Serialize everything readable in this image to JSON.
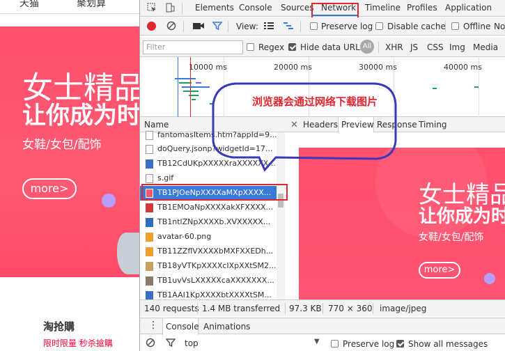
{
  "site": {
    "nav": [
      "天猫",
      "聚划算"
    ],
    "banner": {
      "line1": "女士精品",
      "line2": "让你成为时",
      "sub": "女鞋/女包/配饰",
      "more": "more>"
    },
    "section": {
      "title": "淘抢購",
      "sub": "限时限量 秒杀搶購"
    }
  },
  "devtools": {
    "tabs": [
      "Elements",
      "Console",
      "Sources",
      "Network",
      "Timeline",
      "Profiles",
      "Application"
    ],
    "toolbar": {
      "view": "View:",
      "preserve_log": "Preserve log",
      "disable_cache": "Disable cache",
      "offline": "Offline",
      "no": "No"
    },
    "filter": {
      "placeholder": "Filter",
      "regex": "Regex",
      "hide_data_urls": "Hide data URLs",
      "all": "All",
      "types": [
        "XHR",
        "JS",
        "CSS",
        "Img",
        "Media"
      ]
    },
    "timeline_labels": [
      "10000 ms",
      "20000 ms",
      "30000 ms",
      "40000 ms"
    ],
    "name_header": "Name",
    "requests": [
      "fantomasItems.htm?appId=9...",
      "doQuery.jsonp?widgetId=17...",
      "TB12CdUKpXXXXXraXXXXXX...",
      "s.gif",
      "TB1PJOeNpXXXXaMXpXXXX...",
      "TB1EMOaNpXXXXakXFXXXX...",
      "TB1ntlZNpXXXXb.XVXXXXX...",
      "avatar-60.png",
      "TB11ZZflVXXXXbMXFXXEDh...",
      "TB18yVTKpXXXXcIXpXXtSM2...",
      "TB1uvVsLXXXXXcaXXXXXXX...",
      "TB1AAI1KpXXXXbtXXXXtSM..."
    ],
    "selected_index": 4,
    "detail_tabs": [
      "Headers",
      "Preview",
      "Response",
      "Timing"
    ],
    "active_detail_tab": "Preview",
    "preview": {
      "line1": "女士精品",
      "line2": "让你成为时",
      "sub": "女鞋/女包/配饰",
      "more": "more>"
    },
    "status": {
      "requests": "140 requests",
      "transferred": "1.4 MB transferred",
      "size": "97.3 KB",
      "dims": "770 × 360",
      "mime": "image/jpeg"
    },
    "drawer": {
      "console": "Console",
      "animations": "Animations"
    },
    "console": {
      "context": "top",
      "preserve_log": "Preserve log",
      "show_all": "Show all messages"
    }
  },
  "annotation": {
    "text": "浏览器会通过网络下载图片"
  },
  "colors": {
    "accent": "#3879d9",
    "annotation_red": "#e0262f",
    "banner_pink": "#ff4f6d",
    "callout_blue": "#3a3ab8"
  }
}
